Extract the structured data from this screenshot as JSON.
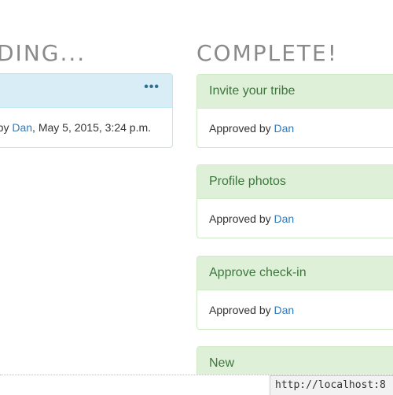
{
  "pending": {
    "title": "DING...",
    "cards": [
      {
        "menu": "•••",
        "prefix": "n by ",
        "user": "Dan",
        "suffix": ", May 5, 2015, 3:24 p.m."
      }
    ]
  },
  "complete": {
    "title": "COMPLETE!",
    "cards": [
      {
        "title": "Invite your tribe",
        "approved_prefix": "Approved by ",
        "user": "Dan"
      },
      {
        "title": "Profile photos",
        "approved_prefix": "Approved by ",
        "user": "Dan"
      },
      {
        "title": "Approve check-in",
        "approved_prefix": "Approved by ",
        "user": "Dan"
      },
      {
        "title": "New"
      }
    ]
  },
  "status_bar": {
    "url": "http://localhost:8"
  },
  "colors": {
    "info_bg": "#d9edf7",
    "info_border": "#bce8f1",
    "success_bg": "#dff0d8",
    "success_text": "#3c763d",
    "link": "#337ab7"
  }
}
